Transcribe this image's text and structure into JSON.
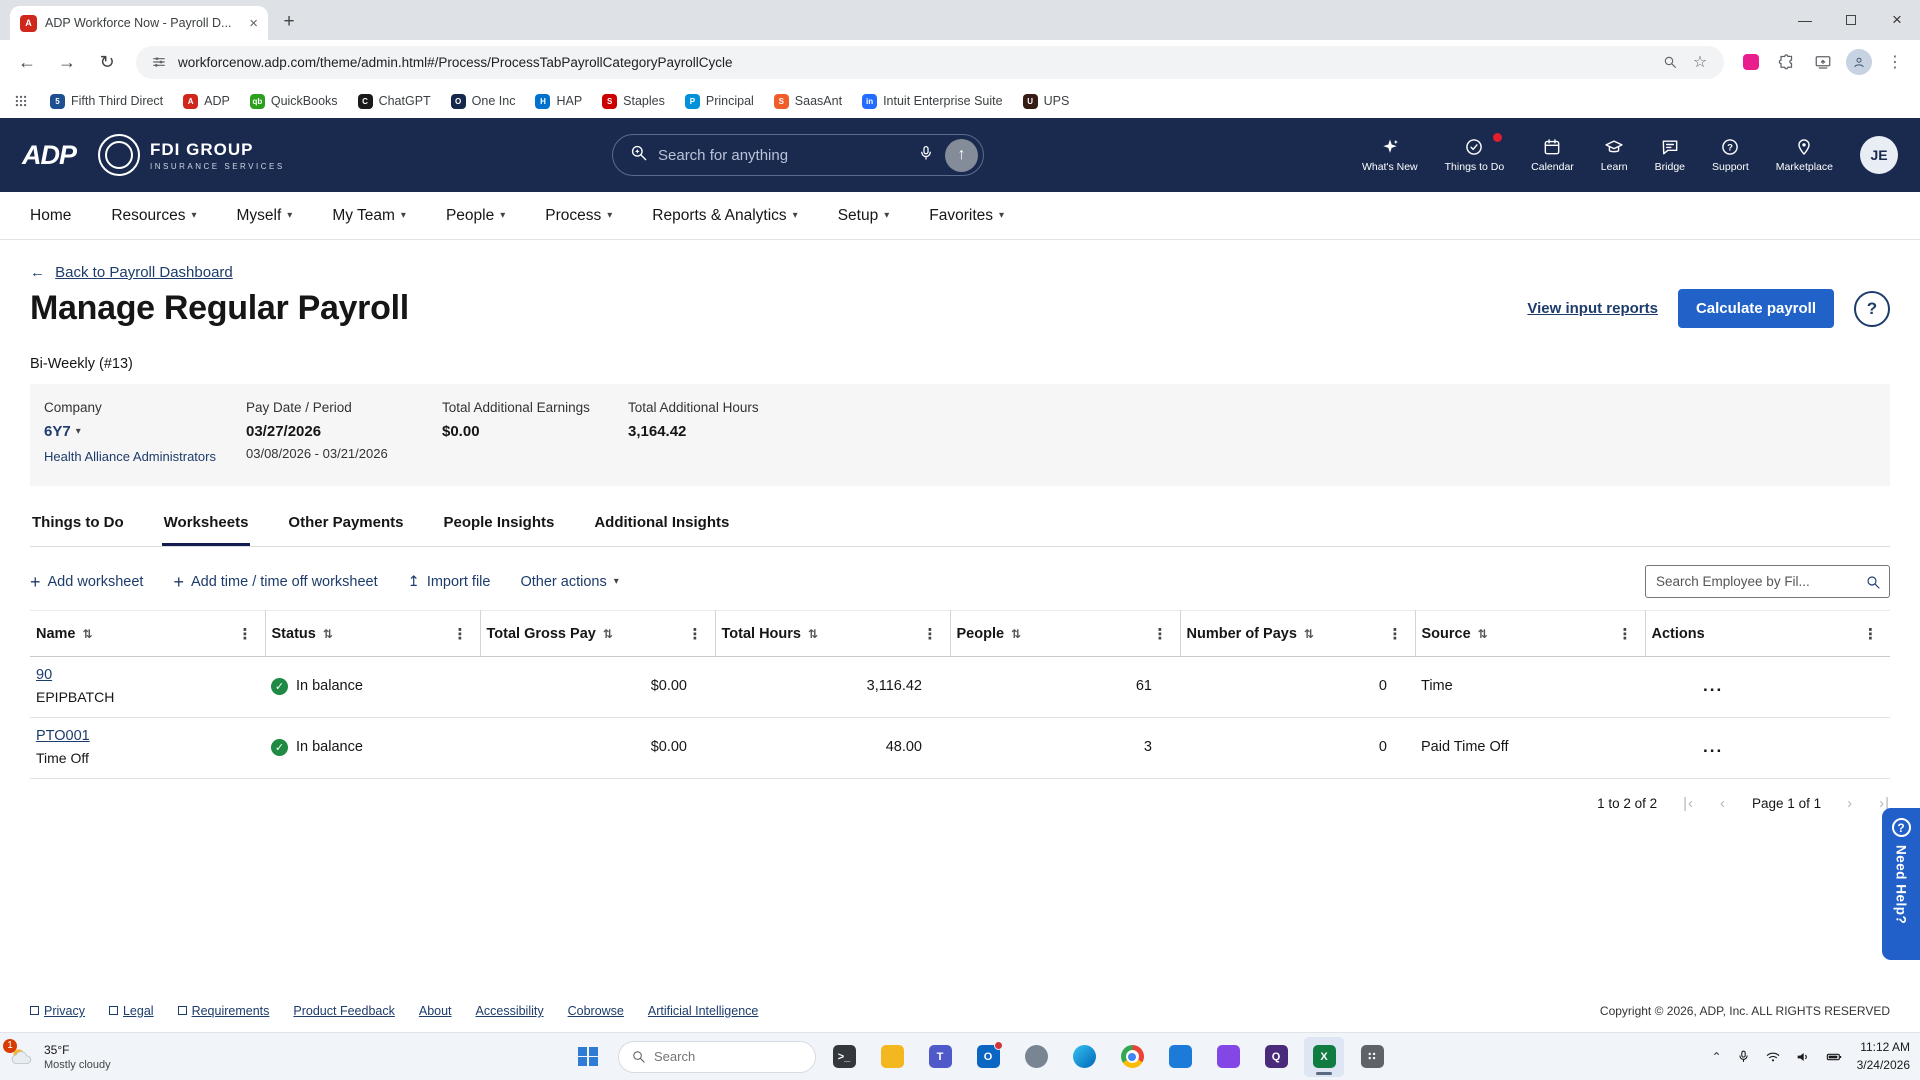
{
  "colors": {
    "header_navy": "#1a2a4e",
    "accent_blue": "#2062c8",
    "link_navy": "#1d3c6b",
    "status_green": "#1e8a44",
    "need_help_blue": "#2160c9"
  },
  "browser": {
    "tab_title": "ADP Workforce Now - Payroll D...",
    "tab_favicon": {
      "initial": "A",
      "color": "#d0271d"
    },
    "url": "workforcenow.adp.com/theme/admin.html#/Process/ProcessTabPayrollCategoryPayrollCycle",
    "bookmarks": [
      {
        "label": "Fifth Third Direct",
        "initial": "5",
        "color": "#1d4f91"
      },
      {
        "label": "ADP",
        "initial": "A",
        "color": "#d0271d"
      },
      {
        "label": "QuickBooks",
        "initial": "qb",
        "color": "#2ca01c"
      },
      {
        "label": "ChatGPT",
        "initial": "C",
        "color": "#1a1a1a"
      },
      {
        "label": "One Inc",
        "initial": "O",
        "color": "#15284b"
      },
      {
        "label": "HAP",
        "initial": "H",
        "color": "#0072ce"
      },
      {
        "label": "Staples",
        "initial": "S",
        "color": "#cc0000"
      },
      {
        "label": "Principal",
        "initial": "P",
        "color": "#0091da"
      },
      {
        "label": "SaasAnt",
        "initial": "S",
        "color": "#f25c2a"
      },
      {
        "label": "Intuit Enterprise Suite",
        "initial": "in",
        "color": "#236cff"
      },
      {
        "label": "UPS",
        "initial": "U",
        "color": "#351c15"
      }
    ]
  },
  "header": {
    "brand": "ADP",
    "company_name_top": "FDI GROUP",
    "company_name_bottom": "INSURANCE SERVICES",
    "search_placeholder": "Search for anything",
    "icons": [
      {
        "label": "What's New"
      },
      {
        "label": "Things to Do"
      },
      {
        "label": "Calendar"
      },
      {
        "label": "Learn"
      },
      {
        "label": "Bridge"
      },
      {
        "label": "Support"
      },
      {
        "label": "Marketplace"
      }
    ],
    "avatar_initials": "JE"
  },
  "nav": {
    "items": [
      {
        "label": "Home"
      },
      {
        "label": "Resources"
      },
      {
        "label": "Myself"
      },
      {
        "label": "My Team"
      },
      {
        "label": "People"
      },
      {
        "label": "Process"
      },
      {
        "label": "Reports & Analytics"
      },
      {
        "label": "Setup"
      },
      {
        "label": "Favorites"
      }
    ]
  },
  "page": {
    "back_link": "Back to Payroll Dashboard",
    "title": "Manage Regular Payroll",
    "view_reports_link": "View input reports",
    "calculate_button": "Calculate payroll",
    "cycle_label": "Bi-Weekly (#13)",
    "summary": {
      "company_label": "Company",
      "company_code": "6Y7",
      "company_name": "Health Alliance Administrators",
      "pay_date_label": "Pay Date / Period",
      "pay_date": "03/27/2026",
      "pay_period": "03/08/2026 - 03/21/2026",
      "earnings_label": "Total Additional Earnings",
      "earnings_value": "$0.00",
      "hours_label": "Total Additional Hours",
      "hours_value": "3,164.42"
    },
    "tabs": [
      "Things to Do",
      "Worksheets",
      "Other Payments",
      "People Insights",
      "Additional Insights"
    ],
    "active_tab": "Worksheets",
    "actions": {
      "add_worksheet": "Add worksheet",
      "add_time": "Add time / time off worksheet",
      "import_file": "Import file",
      "other_actions": "Other actions",
      "search_placeholder": "Search Employee by Fil..."
    },
    "table": {
      "columns": [
        "Name",
        "Status",
        "Total Gross Pay",
        "Total Hours",
        "People",
        "Number of Pays",
        "Source",
        "Actions"
      ],
      "rows": [
        {
          "name": "90",
          "subname": "EPIPBATCH",
          "status": "In balance",
          "gross": "$0.00",
          "hours": "3,116.42",
          "people": "61",
          "pays": "0",
          "source": "Time"
        },
        {
          "name": "PTO001",
          "subname": "Time Off",
          "status": "In balance",
          "gross": "$0.00",
          "hours": "48.00",
          "people": "3",
          "pays": "0",
          "source": "Paid Time Off"
        }
      ],
      "pagination": {
        "range_label": "1 to 2 of 2",
        "page_label": "Page 1 of 1"
      }
    }
  },
  "footer": {
    "links": [
      "Privacy",
      "Legal",
      "Requirements",
      "Product Feedback",
      "About",
      "Accessibility",
      "Cobrowse",
      "Artificial Intelligence"
    ],
    "copyright": "Copyright © 2026, ADP, Inc. ALL RIGHTS RESERVED"
  },
  "need_help": {
    "label": "Need Help?"
  },
  "taskbar": {
    "weather": {
      "badge": "1",
      "temp": "35°F",
      "desc": "Mostly cloudy"
    },
    "search_placeholder": "Search",
    "apps": [
      {
        "name": "terminal",
        "color": "#33373e",
        "letter": ">_"
      },
      {
        "name": "file-explorer",
        "color": "#f3b71f",
        "letter": ""
      },
      {
        "name": "teams",
        "color": "#5059c9",
        "letter": "T"
      },
      {
        "name": "outlook",
        "color": "#0a66c2",
        "letter": "O"
      },
      {
        "name": "people",
        "color": "#7a8594",
        "letter": ""
      },
      {
        "name": "edge",
        "color": "#0067b8",
        "letter": ""
      },
      {
        "name": "chrome",
        "color": "#4285f4",
        "letter": ""
      },
      {
        "name": "photos",
        "color": "#1c7ad9",
        "letter": ""
      },
      {
        "name": "store",
        "color": "#8347e6",
        "letter": ""
      },
      {
        "name": "quickbooks",
        "color": "#4a2a7a",
        "letter": "Q"
      },
      {
        "name": "excel",
        "color": "#107c41",
        "letter": "X"
      },
      {
        "name": "apps-grid",
        "color": "#5f6368",
        "letter": "∷"
      }
    ],
    "tray": {
      "time": "11:12 AM",
      "date": "3/24/2026"
    }
  }
}
